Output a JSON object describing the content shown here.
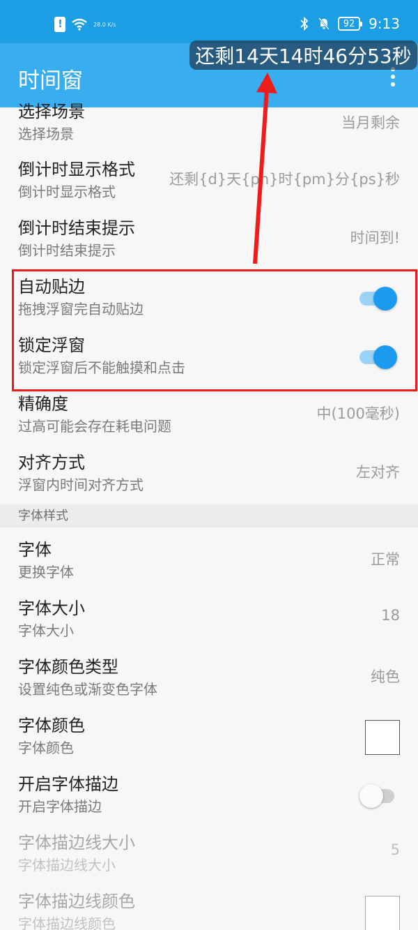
{
  "status_bar": {
    "speed": "28.0 K/s",
    "battery": "92",
    "time": "9:13"
  },
  "app_bar": {
    "title": "时间窗"
  },
  "float_window": {
    "text": "还剩14天14时46分53秒"
  },
  "prefs": [
    {
      "title": "选择场景",
      "summary": "选择场景",
      "value": "当月剩余"
    },
    {
      "title": "倒计时显示格式",
      "summary": "倒计时显示格式",
      "value": "还剩{d}天{ph}时{pm}分{ps}秒"
    },
    {
      "title": "倒计时结束提示",
      "summary": "倒计时结束提示",
      "value": "时间到!"
    },
    {
      "title": "自动贴边",
      "summary": "拖拽浮窗完自动贴边",
      "switch": "on"
    },
    {
      "title": "锁定浮窗",
      "summary": "锁定浮窗后不能触摸和点击",
      "switch": "on"
    },
    {
      "title": "精确度",
      "summary": "过高可能会存在耗电问题",
      "value": "中(100毫秒)"
    },
    {
      "title": "对齐方式",
      "summary": "浮窗内时间对齐方式",
      "value": "左对齐"
    }
  ],
  "category": {
    "label": "字体样式"
  },
  "font_prefs": [
    {
      "title": "字体",
      "summary": "更换字体",
      "value": "正常"
    },
    {
      "title": "字体大小",
      "summary": "字体大小",
      "value": "18"
    },
    {
      "title": "字体颜色类型",
      "summary": "设置纯色或渐变色字体",
      "value": "纯色"
    },
    {
      "title": "字体颜色",
      "summary": "字体颜色",
      "swatch_color": "#ffffff"
    },
    {
      "title": "开启字体描边",
      "summary": "开启字体描边",
      "switch": "off"
    },
    {
      "title": "字体描边线大小",
      "summary": "字体描边线大小",
      "value": "5"
    },
    {
      "title": "字体描边线颜色",
      "summary": "字体描边线颜色"
    }
  ],
  "colors": {
    "status_bar": "#1b9ee3",
    "app_bar": "#38adef",
    "switch_on": "#1a9bf0",
    "annotation": "#ef1c1c"
  },
  "icons": [
    "sim-alert-icon",
    "wifi-icon",
    "bluetooth-icon",
    "mute-bell-icon",
    "battery-icon",
    "more-vert-icon"
  ]
}
